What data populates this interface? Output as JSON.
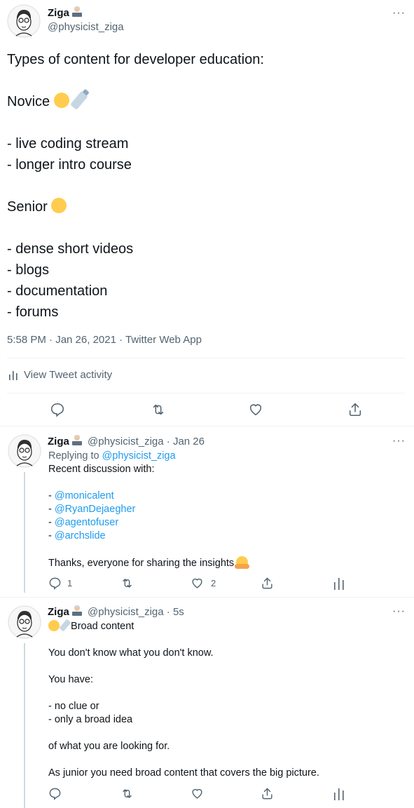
{
  "main_tweet": {
    "author_name": "Ziga",
    "author_handle": "@physicist_ziga",
    "more_label": "···",
    "title_line": "Types of content for developer education:",
    "novice_label": "Novice",
    "novice_items": [
      "- live coding stream",
      "- longer intro course"
    ],
    "senior_label": "Senior",
    "senior_items": [
      "- dense short videos",
      "- blogs",
      "- documentation",
      "- forums"
    ],
    "timestamp": "5:58 PM · Jan 26, 2021 · Twitter Web App",
    "activity_label": "View Tweet activity"
  },
  "reply1": {
    "author_name": "Ziga",
    "author_handle": "@physicist_ziga",
    "date": "· Jan 26",
    "replying_prefix": "Replying to",
    "replying_handle": "@physicist_ziga",
    "intro": "Recent discussion with:",
    "mentions": [
      "@monicalent",
      "@RyanDejaegher",
      "@agentofuser",
      "@archslide"
    ],
    "mention_prefix": "- ",
    "thanks": "Thanks, everyone for sharing the insights",
    "reply_count": "1",
    "like_count": "2"
  },
  "reply2": {
    "author_name": "Ziga",
    "author_handle": "@physicist_ziga",
    "date": "· 5s",
    "heading": "Broad content",
    "line1": "You don't know what you don't know.",
    "line2": "You have:",
    "line3": "- no clue or",
    "line4": "- only a broad idea",
    "line5": "of what you are looking for.",
    "line6": "As junior you need broad content that covers the big picture."
  },
  "colors": {
    "accent": "#1d9bf0",
    "muted": "#536471",
    "divider": "#eff3f4"
  }
}
